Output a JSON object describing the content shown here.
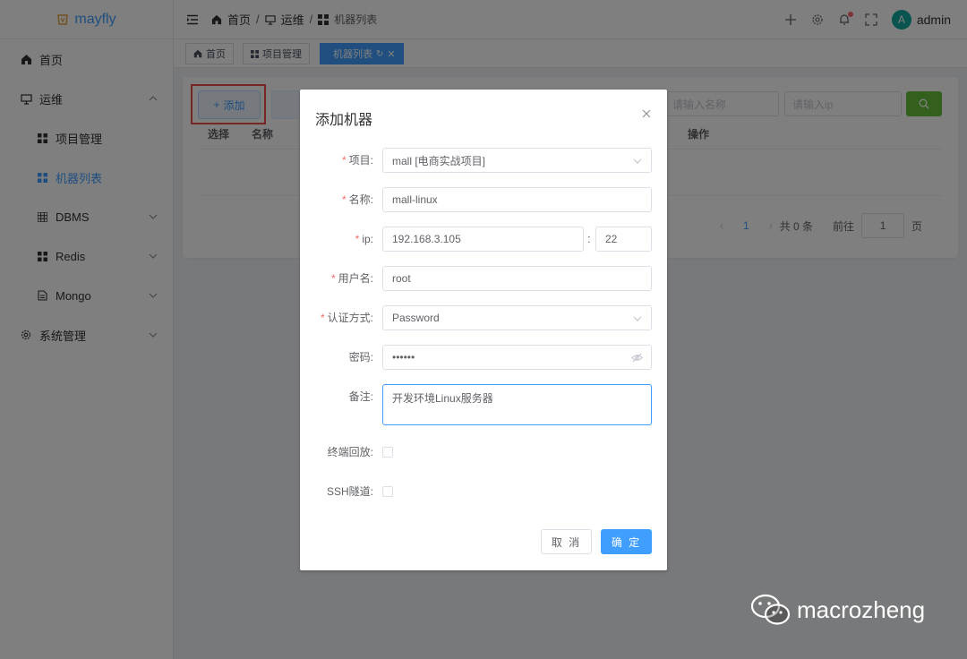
{
  "app": {
    "name": "mayfly"
  },
  "sidebar": {
    "items": [
      {
        "label": "首页",
        "icon": "home-icon"
      },
      {
        "label": "运维",
        "icon": "monitor-icon"
      },
      {
        "label": "项目管理",
        "icon": "grid-icon"
      },
      {
        "label": "机器列表",
        "icon": "grid-icon"
      },
      {
        "label": "DBMS",
        "icon": "table-icon"
      },
      {
        "label": "Redis",
        "icon": "grid-icon"
      },
      {
        "label": "Mongo",
        "icon": "document-icon"
      },
      {
        "label": "系统管理",
        "icon": "gear-icon"
      }
    ]
  },
  "header": {
    "breadcrumb": [
      "首页",
      "运维",
      "机器列表"
    ],
    "user": {
      "avatar_letter": "A",
      "name": "admin"
    }
  },
  "tags": [
    "首页",
    "项目管理",
    "机器列表"
  ],
  "toolbar": {
    "add_label": "添加"
  },
  "search": {
    "name_placeholder": "请输入名称",
    "ip_placeholder": "请输入ip"
  },
  "table": {
    "headers": [
      "选择",
      "名称",
      "操作"
    ]
  },
  "pagination": {
    "current_page": "1",
    "total": "共 0 条",
    "goto_label": "前往",
    "goto_value": "1",
    "page_suffix": "页"
  },
  "dialog": {
    "title": "添加机器",
    "fields": {
      "project": {
        "label": "项目:",
        "value": "mall [电商实战项目]"
      },
      "name": {
        "label": "名称:",
        "value": "mall-linux"
      },
      "ip": {
        "label": "ip:",
        "value": "192.168.3.105",
        "port": "22"
      },
      "username": {
        "label": "用户名:",
        "value": "root"
      },
      "auth": {
        "label": "认证方式:",
        "value": "Password"
      },
      "password": {
        "label": "密码:",
        "value": "••••••"
      },
      "remark": {
        "label": "备注:",
        "value": "开发环境Linux服务器"
      },
      "playback": {
        "label": "终端回放:"
      },
      "ssh_tunnel": {
        "label": "SSH隧道:"
      }
    },
    "cancel_label": "取 消",
    "ok_label": "确 定"
  },
  "watermark": {
    "text": "macrozheng"
  },
  "colors": {
    "primary": "#409eff",
    "success": "#67c23a",
    "danger": "#f56c6c",
    "highlight_box": "#f04a4a"
  }
}
